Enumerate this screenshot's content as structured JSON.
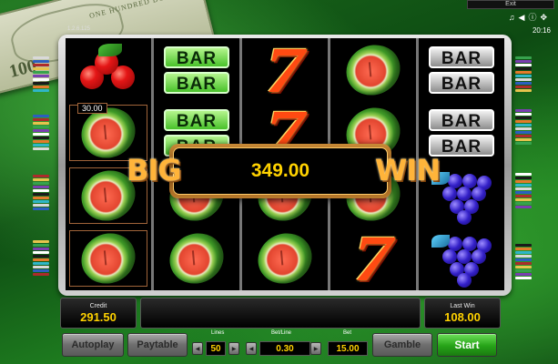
{
  "top_menu": {
    "exit_label": "Exit",
    "icons": [
      "music-note-icon",
      "volume-icon",
      "info-icon",
      "fullscreen-icon"
    ],
    "clock": "20:16"
  },
  "version_label": "1.2.6.125",
  "money_note": {
    "denomination": "100",
    "text": "ONE HUNDRED DOLLARS"
  },
  "win_line_value": "30.00",
  "big_win": {
    "big": "BIG",
    "win": "WIN",
    "amount": "349.00"
  },
  "bar_text": "BAR",
  "seven_text": "7",
  "reels": [
    [
      "cherries",
      "melon",
      "melon",
      "melon"
    ],
    [
      "bar-green",
      "bar-green",
      "melon",
      "melon"
    ],
    [
      "seven",
      "seven",
      "melon",
      "melon"
    ],
    [
      "melon",
      "melon",
      "melon",
      "seven"
    ],
    [
      "bar-silver",
      "bar-silver",
      "grapes",
      "grapes"
    ]
  ],
  "info": {
    "credit_label": "Credit",
    "credit_value": "291.50",
    "last_win_label": "Last Win",
    "last_win_value": "108.00"
  },
  "buttons": {
    "autoplay": "Autoplay",
    "paytable": "Paytable",
    "gamble": "Gamble",
    "start": "Start"
  },
  "steppers": {
    "lines_label": "Lines",
    "lines_value": "50",
    "betline_label": "Bet/Line",
    "betline_value": "0.30",
    "bet_label": "Bet",
    "bet_value": "15.00"
  },
  "colors": {
    "gold": "#ffd200",
    "start_green": "#26a318",
    "win_orange": "#ffb43a"
  }
}
